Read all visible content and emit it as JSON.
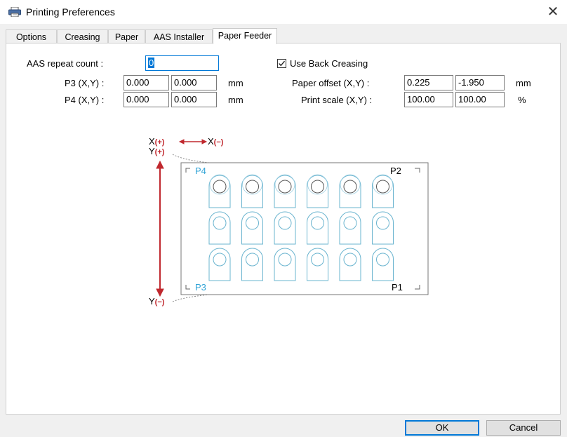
{
  "window": {
    "title": "Printing Preferences",
    "close_glyph": "✕"
  },
  "tabs": [
    {
      "label": "Options",
      "active": false
    },
    {
      "label": "Creasing",
      "active": false
    },
    {
      "label": "Paper",
      "active": false
    },
    {
      "label": "AAS Installer",
      "active": false
    },
    {
      "label": "Paper Feeder",
      "active": true
    }
  ],
  "form": {
    "aas_repeat_label": "AAS repeat count :",
    "aas_repeat_value": "0",
    "p3_label": "P3 (X,Y) :",
    "p3_x": "0.000",
    "p3_y": "0.000",
    "p4_label": "P4 (X,Y) :",
    "p4_x": "0.000",
    "p4_y": "0.000",
    "unit_mm": "mm",
    "use_back_creasing_label": "Use Back Creasing",
    "use_back_creasing_checked": true,
    "paper_offset_label": "Paper offset (X,Y) :",
    "paper_offset_x": "0.225",
    "paper_offset_y": "-1.950",
    "print_scale_label": "Print scale (X,Y) :",
    "print_scale_x": "100.00",
    "print_scale_y": "100.00",
    "unit_percent": "%"
  },
  "diagram": {
    "x_plus": "X",
    "x_plus_sign": "(+)",
    "x_minus": "X",
    "x_minus_sign": "(−)",
    "y_plus": "Y",
    "y_plus_sign": "(+)",
    "y_minus": "Y",
    "y_minus_sign": "(−)",
    "p1": "P1",
    "p2": "P2",
    "p3": "P3",
    "p4": "P4",
    "accent_color": "#c0282e",
    "marker_color": "#2fa3d6",
    "rows": 3,
    "cols": 6
  },
  "buttons": {
    "ok": "OK",
    "cancel": "Cancel"
  }
}
